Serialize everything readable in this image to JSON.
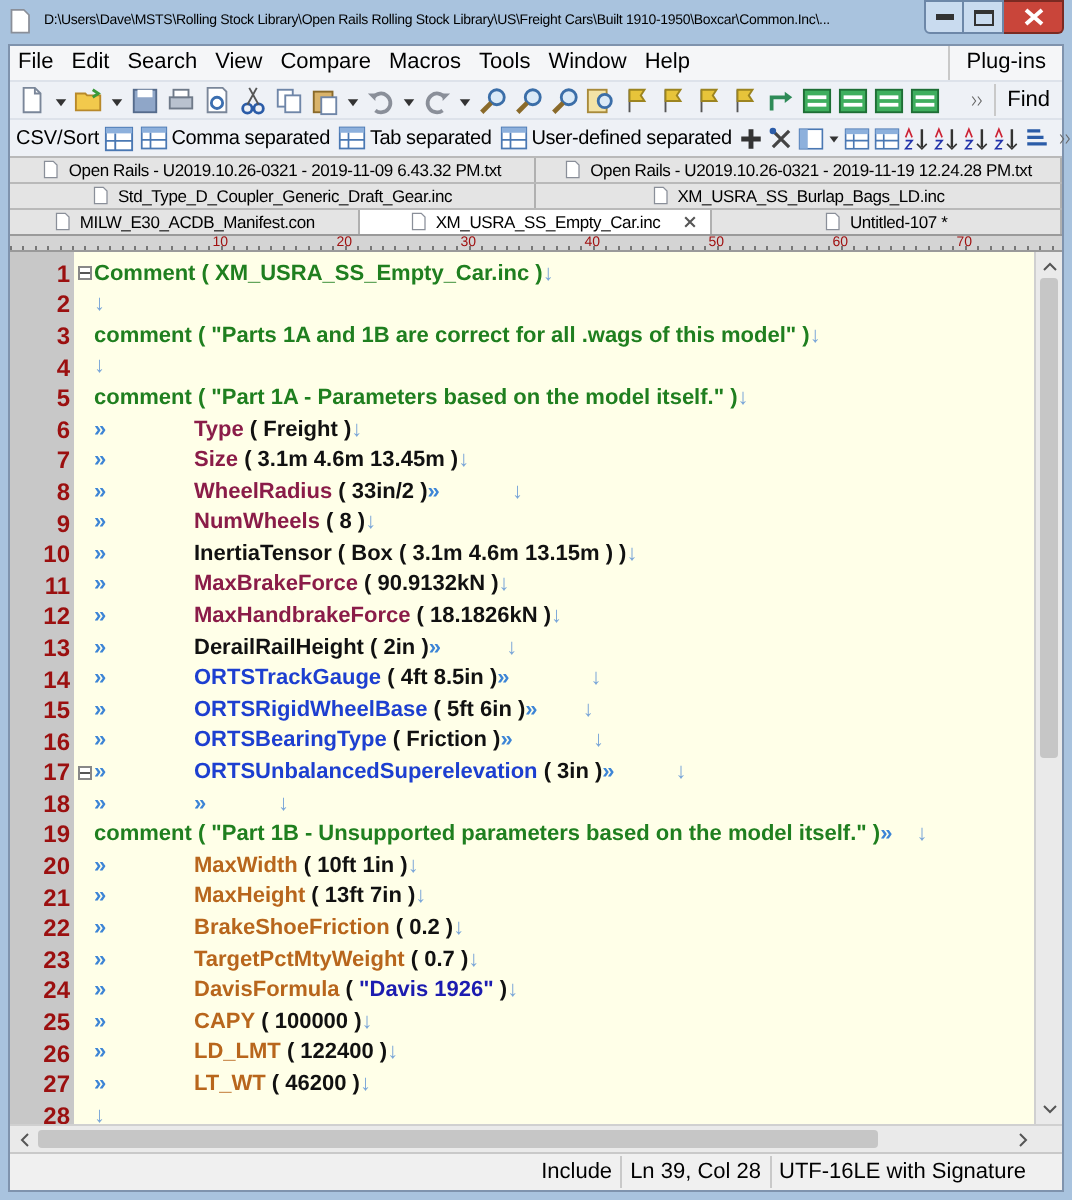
{
  "window": {
    "title": "D:\\Users\\Dave\\MSTS\\Rolling Stock Library\\Open Rails Rolling Stock Library\\US\\Freight Cars\\Built 1910-1950\\Boxcar\\Common.Inc\\..."
  },
  "menu": [
    "File",
    "Edit",
    "Search",
    "View",
    "Compare",
    "Macros",
    "Tools",
    "Window",
    "Help"
  ],
  "plugins_label": "Plug-ins",
  "find_label": "Find",
  "csv_toolbar": {
    "label": "CSV/Sort",
    "buttons": [
      "Comma separated",
      "Tab separated",
      "User-defined separated"
    ]
  },
  "tab_rows": [
    [
      {
        "label": "Open Rails - U2019.10.26-0321 - 2019-11-09 6.43.32 PM.txt",
        "selected": false
      },
      {
        "label": "Open Rails - U2019.10.26-0321 - 2019-11-19 12.24.28 PM.txt",
        "selected": false
      }
    ],
    [
      {
        "label": "Std_Type_D_Coupler_Generic_Draft_Gear.inc",
        "selected": false
      },
      {
        "label": "XM_USRA_SS_Burlap_Bags_LD.inc",
        "selected": false
      }
    ],
    [
      {
        "label": "MILW_E30_ACDB_Manifest.con",
        "selected": false
      },
      {
        "label": "XM_USRA_SS_Empty_Car.inc",
        "selected": true
      },
      {
        "label": "Untitled-107 *",
        "selected": false
      }
    ]
  ],
  "ruler_marks": [
    "10",
    "20",
    "30",
    "40",
    "50",
    "60",
    "70"
  ],
  "editor": {
    "lines": [
      {
        "number": "1",
        "fold": true,
        "tokens": [
          {
            "kind": "comment",
            "text": "Comment ( XM_USRA_SS_Empty_Car.inc )"
          }
        ],
        "eol": "↓"
      },
      {
        "number": "2",
        "fold": false,
        "eol": "↓"
      },
      {
        "number": "3",
        "fold": false,
        "tokens": [
          {
            "kind": "comment",
            "text": "comment ( \"Parts 1A and 1B are correct for all .wags of this model\" )"
          }
        ],
        "eol": "↓"
      },
      {
        "number": "4",
        "fold": false,
        "eol": "↓"
      },
      {
        "number": "5",
        "fold": false,
        "tokens": [
          {
            "kind": "comment",
            "text": "comment ( \"Part 1A - Parameters based on the model itself.\" )"
          }
        ],
        "eol": "↓"
      },
      {
        "number": "6",
        "fold": false,
        "tokens": [
          {
            "kind": "tab",
            "text": "»"
          },
          {
            "kind": "key",
            "text": "Type"
          },
          {
            "kind": "plain",
            "text": " ( Freight )"
          }
        ],
        "eol": "↓"
      },
      {
        "number": "7",
        "fold": false,
        "tokens": [
          {
            "kind": "tab",
            "text": "»"
          },
          {
            "kind": "key",
            "text": "Size"
          },
          {
            "kind": "plain",
            "text": " ( 3.1m 4.6m 13.45m )"
          }
        ],
        "eol": "↓"
      },
      {
        "number": "8",
        "fold": false,
        "tokens": [
          {
            "kind": "tab",
            "text": "»"
          },
          {
            "kind": "key",
            "text": "WheelRadius"
          },
          {
            "kind": "plain",
            "text": " ( 33in/2 )"
          },
          {
            "kind": "tab",
            "text": "»"
          }
        ],
        "eol": "↓"
      },
      {
        "number": "9",
        "fold": false,
        "tokens": [
          {
            "kind": "tab",
            "text": "»"
          },
          {
            "kind": "key",
            "text": "NumWheels"
          },
          {
            "kind": "plain",
            "text": " ( 8 )"
          }
        ],
        "eol": "↓"
      },
      {
        "number": "10",
        "fold": false,
        "tokens": [
          {
            "kind": "tab",
            "text": "»"
          },
          {
            "kind": "plain",
            "text": "InertiaTensor ( Box ( 3.1m 4.6m 13.15m ) )"
          }
        ],
        "eol": "↓"
      },
      {
        "number": "11",
        "fold": false,
        "tokens": [
          {
            "kind": "tab",
            "text": "»"
          },
          {
            "kind": "key",
            "text": "MaxBrakeForce"
          },
          {
            "kind": "plain",
            "text": " ( 90.9132kN )"
          }
        ],
        "eol": "↓"
      },
      {
        "number": "12",
        "fold": false,
        "tokens": [
          {
            "kind": "tab",
            "text": "»"
          },
          {
            "kind": "key",
            "text": "MaxHandbrakeForce"
          },
          {
            "kind": "plain",
            "text": " ( 18.1826kN )"
          }
        ],
        "eol": "↓"
      },
      {
        "number": "13",
        "fold": false,
        "tokens": [
          {
            "kind": "tab",
            "text": "»"
          },
          {
            "kind": "plain",
            "text": "DerailRailHeight ( 2in )"
          },
          {
            "kind": "tab",
            "text": "»"
          }
        ],
        "eol": "↓"
      },
      {
        "number": "14",
        "fold": false,
        "tokens": [
          {
            "kind": "tab",
            "text": "»"
          },
          {
            "kind": "orts",
            "text": "ORTSTrackGauge"
          },
          {
            "kind": "plain",
            "text": " ( 4ft 8.5in )"
          },
          {
            "kind": "tab",
            "text": "»"
          }
        ],
        "eol": "↓"
      },
      {
        "number": "15",
        "fold": false,
        "tokens": [
          {
            "kind": "tab",
            "text": "»"
          },
          {
            "kind": "orts",
            "text": "ORTSRigidWheelBase"
          },
          {
            "kind": "plain",
            "text": " ( 5ft 6in )"
          },
          {
            "kind": "tab",
            "text": "»"
          }
        ],
        "eol": "↓"
      },
      {
        "number": "16",
        "fold": false,
        "tokens": [
          {
            "kind": "tab",
            "text": "»"
          },
          {
            "kind": "orts",
            "text": "ORTSBearingType"
          },
          {
            "kind": "plain",
            "text": " ( Friction )"
          },
          {
            "kind": "tab",
            "text": "»"
          }
        ],
        "eol": "↓"
      },
      {
        "number": "17",
        "fold": true,
        "tokens": [
          {
            "kind": "tab",
            "text": "»"
          },
          {
            "kind": "orts",
            "text": "ORTSUnbalancedSuperelevation"
          },
          {
            "kind": "plain",
            "text": " ( 3in )"
          },
          {
            "kind": "tab",
            "text": "»"
          }
        ],
        "eol": "↓"
      },
      {
        "number": "18",
        "fold": false,
        "tokens": [
          {
            "kind": "tab",
            "text": "»"
          },
          {
            "kind": "tab",
            "text": "»"
          }
        ],
        "eol": "↓"
      },
      {
        "number": "19",
        "fold": false,
        "tokens": [
          {
            "kind": "comment",
            "text": "comment ( \"Part 1B - Unsupported parameters based on the model itself.\" )"
          },
          {
            "kind": "tab",
            "text": "»"
          }
        ],
        "eol": "↓"
      },
      {
        "number": "20",
        "fold": false,
        "tokens": [
          {
            "kind": "tab",
            "text": "»"
          },
          {
            "kind": "ext",
            "text": "MaxWidth"
          },
          {
            "kind": "plain",
            "text": " ( 10ft 1in )"
          }
        ],
        "eol": "↓"
      },
      {
        "number": "21",
        "fold": false,
        "tokens": [
          {
            "kind": "tab",
            "text": "»"
          },
          {
            "kind": "ext",
            "text": "MaxHeight"
          },
          {
            "kind": "plain",
            "text": " ( 13ft 7in )"
          }
        ],
        "eol": "↓"
      },
      {
        "number": "22",
        "fold": false,
        "tokens": [
          {
            "kind": "tab",
            "text": "»"
          },
          {
            "kind": "ext",
            "text": "BrakeShoeFriction"
          },
          {
            "kind": "plain",
            "text": " ( 0.2 )"
          }
        ],
        "eol": "↓"
      },
      {
        "number": "23",
        "fold": false,
        "tokens": [
          {
            "kind": "tab",
            "text": "»"
          },
          {
            "kind": "ext",
            "text": "TargetPctMtyWeight"
          },
          {
            "kind": "plain",
            "text": " ( 0.7 )"
          }
        ],
        "eol": "↓"
      },
      {
        "number": "24",
        "fold": false,
        "tokens": [
          {
            "kind": "tab",
            "text": "»"
          },
          {
            "kind": "ext",
            "text": "DavisFormula"
          },
          {
            "kind": "plain",
            "text": " ( "
          },
          {
            "kind": "string",
            "text": "\"Davis 1926\""
          },
          {
            "kind": "plain",
            "text": " )"
          }
        ],
        "eol": "↓"
      },
      {
        "number": "25",
        "fold": false,
        "tokens": [
          {
            "kind": "tab",
            "text": "»"
          },
          {
            "kind": "ext",
            "text": "CAPY"
          },
          {
            "kind": "plain",
            "text": " ( 100000 )"
          }
        ],
        "eol": "↓"
      },
      {
        "number": "26",
        "fold": false,
        "tokens": [
          {
            "kind": "tab",
            "text": "»"
          },
          {
            "kind": "ext",
            "text": "LD_LMT"
          },
          {
            "kind": "plain",
            "text": " ( 122400 )"
          }
        ],
        "eol": "↓"
      },
      {
        "number": "27",
        "fold": false,
        "tokens": [
          {
            "kind": "tab",
            "text": "»"
          },
          {
            "kind": "ext",
            "text": "LT_WT"
          },
          {
            "kind": "plain",
            "text": " ( 46200 )"
          }
        ],
        "eol": "↓"
      },
      {
        "number": "28",
        "fold": false,
        "eol": "↓"
      }
    ]
  },
  "status_bar": [
    "Include",
    "Ln 39, Col 28",
    "UTF-16LE with Signature"
  ]
}
